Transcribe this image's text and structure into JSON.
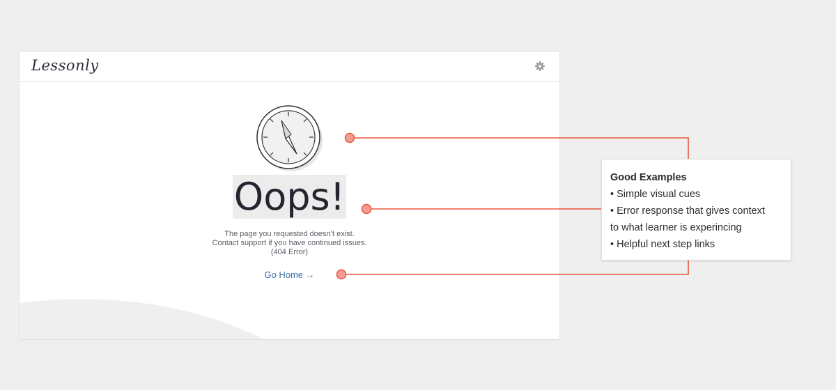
{
  "app": {
    "logo_text": "Lessonly",
    "settings_icon": "gear-icon"
  },
  "error_page": {
    "illustration_icon": "compass-icon",
    "heading": "Oops!",
    "message_lines": [
      "The page you requested doesn’t exist.",
      "Contact support if you have continued issues.",
      "(404 Error)"
    ],
    "go_home_label": "Go Home →"
  },
  "annotation": {
    "title": "Good Examples",
    "bullets": [
      "• Simple visual cues",
      "• Error response that gives context",
      "to what learner is experincing",
      "• Helpful next step links"
    ],
    "connector_color": "#e8553f",
    "marker_fill": "#f59c93"
  }
}
